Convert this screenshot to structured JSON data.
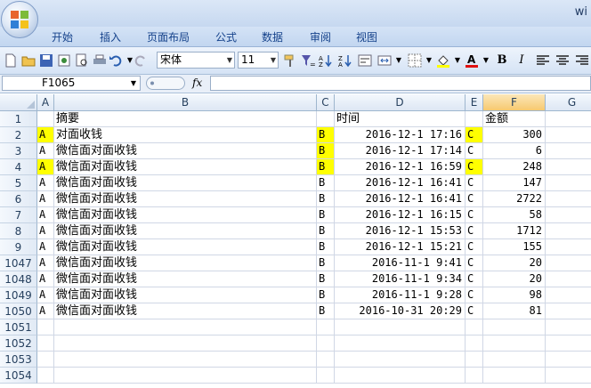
{
  "window": {
    "title_fragment": "wi"
  },
  "ribbon": {
    "tabs": [
      "开始",
      "插入",
      "页面布局",
      "公式",
      "数据",
      "审阅",
      "视图"
    ]
  },
  "toolbar": {
    "font_name": "宋体",
    "font_size": "11",
    "bold": "B",
    "italic": "I"
  },
  "formula_bar": {
    "name_box": "F1065",
    "fx": "fx",
    "content": ""
  },
  "colors": {
    "highlight": "#ffff00",
    "header_selected": "#f7c96f"
  },
  "columns": [
    "A",
    "B",
    "C",
    "D",
    "E",
    "F",
    "G"
  ],
  "rows": [
    {
      "n": "1",
      "a": "",
      "b": "摘要",
      "c": "",
      "d": "时间",
      "e": "",
      "f": "金额",
      "hl": []
    },
    {
      "n": "2",
      "a": "A",
      "b": "对面收钱",
      "c": "B",
      "d": "2016-12-1 17:16",
      "e": "C",
      "f": "300",
      "hl": [
        "a",
        "c",
        "e"
      ]
    },
    {
      "n": "3",
      "a": "A",
      "b": "微信面对面收钱",
      "c": "B",
      "d": "2016-12-1 17:14",
      "e": "C",
      "f": "6",
      "hl": [
        "c"
      ]
    },
    {
      "n": "4",
      "a": "A",
      "b": "微信面对面收钱",
      "c": "B",
      "d": "2016-12-1 16:59",
      "e": "C",
      "f": "248",
      "hl": [
        "a",
        "c",
        "e"
      ]
    },
    {
      "n": "5",
      "a": "A",
      "b": "微信面对面收钱",
      "c": "B",
      "d": "2016-12-1 16:41",
      "e": "C",
      "f": "147",
      "hl": []
    },
    {
      "n": "6",
      "a": "A",
      "b": "微信面对面收钱",
      "c": "B",
      "d": "2016-12-1 16:41",
      "e": "C",
      "f": "2722",
      "hl": []
    },
    {
      "n": "7",
      "a": "A",
      "b": "微信面对面收钱",
      "c": "B",
      "d": "2016-12-1 16:15",
      "e": "C",
      "f": "58",
      "hl": []
    },
    {
      "n": "8",
      "a": "A",
      "b": "微信面对面收钱",
      "c": "B",
      "d": "2016-12-1 15:53",
      "e": "C",
      "f": "1712",
      "hl": []
    },
    {
      "n": "9",
      "a": "A",
      "b": "微信面对面收钱",
      "c": "B",
      "d": "2016-12-1 15:21",
      "e": "C",
      "f": "155",
      "hl": []
    },
    {
      "n": "1047",
      "a": "A",
      "b": "微信面对面收钱",
      "c": "B",
      "d": "2016-11-1 9:41",
      "e": "C",
      "f": "20",
      "hl": []
    },
    {
      "n": "1048",
      "a": "A",
      "b": "微信面对面收钱",
      "c": "B",
      "d": "2016-11-1 9:34",
      "e": "C",
      "f": "20",
      "hl": []
    },
    {
      "n": "1049",
      "a": "A",
      "b": "微信面对面收钱",
      "c": "B",
      "d": "2016-11-1 9:28",
      "e": "C",
      "f": "98",
      "hl": []
    },
    {
      "n": "1050",
      "a": "A",
      "b": "微信面对面收钱",
      "c": "B",
      "d": "2016-10-31 20:29",
      "e": "C",
      "f": "81",
      "hl": []
    },
    {
      "n": "1051",
      "a": "",
      "b": "",
      "c": "",
      "d": "",
      "e": "",
      "f": "",
      "hl": []
    },
    {
      "n": "1052",
      "a": "",
      "b": "",
      "c": "",
      "d": "",
      "e": "",
      "f": "",
      "hl": []
    },
    {
      "n": "1053",
      "a": "",
      "b": "",
      "c": "",
      "d": "",
      "e": "",
      "f": "",
      "hl": []
    },
    {
      "n": "1054",
      "a": "",
      "b": "",
      "c": "",
      "d": "",
      "e": "",
      "f": "",
      "hl": []
    }
  ]
}
